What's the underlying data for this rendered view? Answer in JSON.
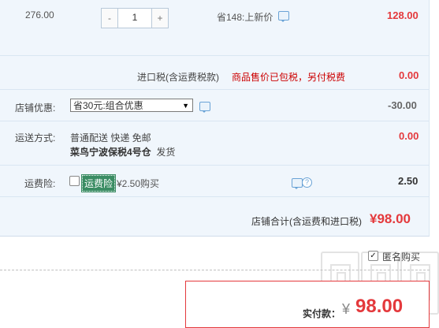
{
  "item": {
    "unit_price": "276.00",
    "quantity": "1",
    "minus": "-",
    "plus": "+",
    "saving_text": "省148:上新价",
    "subtotal": "128.00"
  },
  "tax": {
    "label": "进口税(含运费税款)",
    "note": "商品售价已包税，另付税费",
    "value": "0.00"
  },
  "discount": {
    "label": "店铺优惠:",
    "selected": "省30元:组合优惠",
    "value": "-30.00"
  },
  "shipping": {
    "label": "运送方式:",
    "method": "普通配送 快递 免邮",
    "warehouse": "菜鸟宁波保税4号仓",
    "dispatch": "发货",
    "value": "0.00"
  },
  "insurance": {
    "label": "运费险:",
    "tag": "运费险",
    "text": "¥2.50购买",
    "value": "2.50"
  },
  "store_total": {
    "label": "店铺合计(含运费和进口税)",
    "value": "¥98.00"
  },
  "anonymous": {
    "label": "匿名购买",
    "checkmark": "✓"
  },
  "payment": {
    "label": "实付款：",
    "currency": "¥",
    "amount": "98.00"
  },
  "colors": {
    "accent_red": "#e4393c",
    "panel_bg": "#f0f6fc",
    "insurance_green": "#3a8c63"
  }
}
